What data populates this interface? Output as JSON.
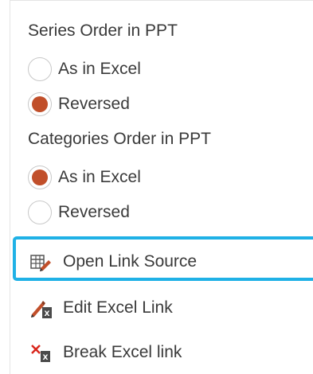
{
  "series_order": {
    "heading": "Series Order in PPT",
    "options": [
      {
        "label": "As in Excel",
        "checked": false
      },
      {
        "label": "Reversed",
        "checked": true
      }
    ]
  },
  "categories_order": {
    "heading": "Categories Order in PPT",
    "options": [
      {
        "label": "As in Excel",
        "checked": true
      },
      {
        "label": "Reversed",
        "checked": false
      }
    ]
  },
  "actions": {
    "open_link_source": "Open Link Source",
    "edit_excel_link": "Edit Excel Link",
    "break_excel_link": "Break Excel link"
  },
  "colors": {
    "radio_selected": "#c14f2a",
    "highlight": "#1fb1e6",
    "edit_icon": "#c14f2a",
    "break_icon": "#d9261c"
  }
}
